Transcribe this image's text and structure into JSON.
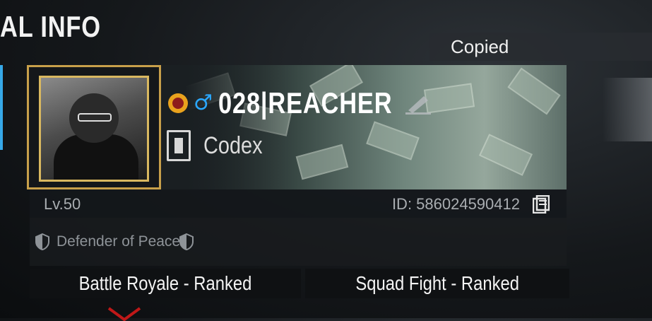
{
  "page": {
    "title": "AL INFO"
  },
  "profile": {
    "name": "028|REACHER",
    "clan": "Codex",
    "level": "Lv.50",
    "id": "ID: 586024590412",
    "honor_title": "Defender of Peace",
    "toast": "Copied",
    "gender_symbol": "♂",
    "icons": [
      "flag-icon",
      "male-icon",
      "edit-icon",
      "clan-icon",
      "copy-icon",
      "shield-icon"
    ]
  },
  "modes": {
    "battle_royale": "Battle Royale - Ranked",
    "squad_fight": "Squad Fight - Ranked"
  },
  "colors": {
    "accent": "#36a8e8",
    "gold_frame": "#c8a04a",
    "male": "#2aa7ff"
  }
}
